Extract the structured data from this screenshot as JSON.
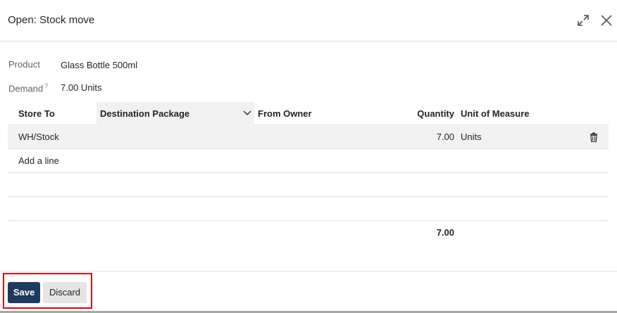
{
  "dialog": {
    "title": "Open: Stock move"
  },
  "form": {
    "product_label": "Product",
    "product_value": "Glass Bottle 500ml",
    "demand_label": "Demand",
    "demand_help": "?",
    "demand_value": "7.00 Units"
  },
  "table": {
    "headers": {
      "store_to": "Store To",
      "destination_package": "Destination Package",
      "from_owner": "From Owner",
      "quantity": "Quantity",
      "unit_of_measure": "Unit of Measure"
    },
    "rows": [
      {
        "store_to": "WH/Stock",
        "destination_package": "",
        "from_owner": "",
        "quantity": "7.00",
        "unit": "Units"
      }
    ],
    "add_line": "Add a line",
    "total_quantity": "7.00"
  },
  "footer": {
    "save_label": "Save",
    "discard_label": "Discard"
  },
  "icons": {
    "expand": "expand-icon",
    "close": "close-icon",
    "dropdown": "chevron-down-icon",
    "delete": "trash-icon"
  },
  "colors": {
    "primary": "#1f3a5f",
    "highlight": "#e3000f"
  }
}
